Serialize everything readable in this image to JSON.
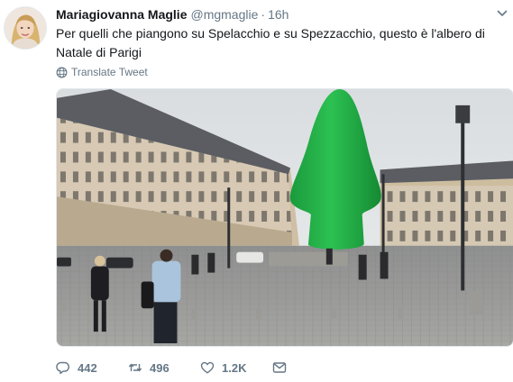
{
  "tweet": {
    "display_name": "Mariagiovanna Maglie",
    "handle": "@mgmaglie",
    "separator": "·",
    "timestamp": "16h",
    "text": "Per quelli che piangono su Spelacchio e su Spezzacchio, questo è l'albero di Natale di Parigi",
    "translate_label": "Translate Tweet",
    "media_alt": "Green inflatable sculpture in Place Vendôme, Paris",
    "stats": {
      "replies": "442",
      "retweets": "496",
      "likes": "1.2K"
    }
  },
  "icons": {
    "caret": "chevron-down-icon",
    "translate": "globe-icon",
    "reply": "reply-icon",
    "retweet": "retweet-icon",
    "like": "heart-icon",
    "dm": "envelope-icon"
  },
  "colors": {
    "text_primary": "#14171a",
    "text_secondary": "#657786",
    "border": "#e1e8ed"
  }
}
